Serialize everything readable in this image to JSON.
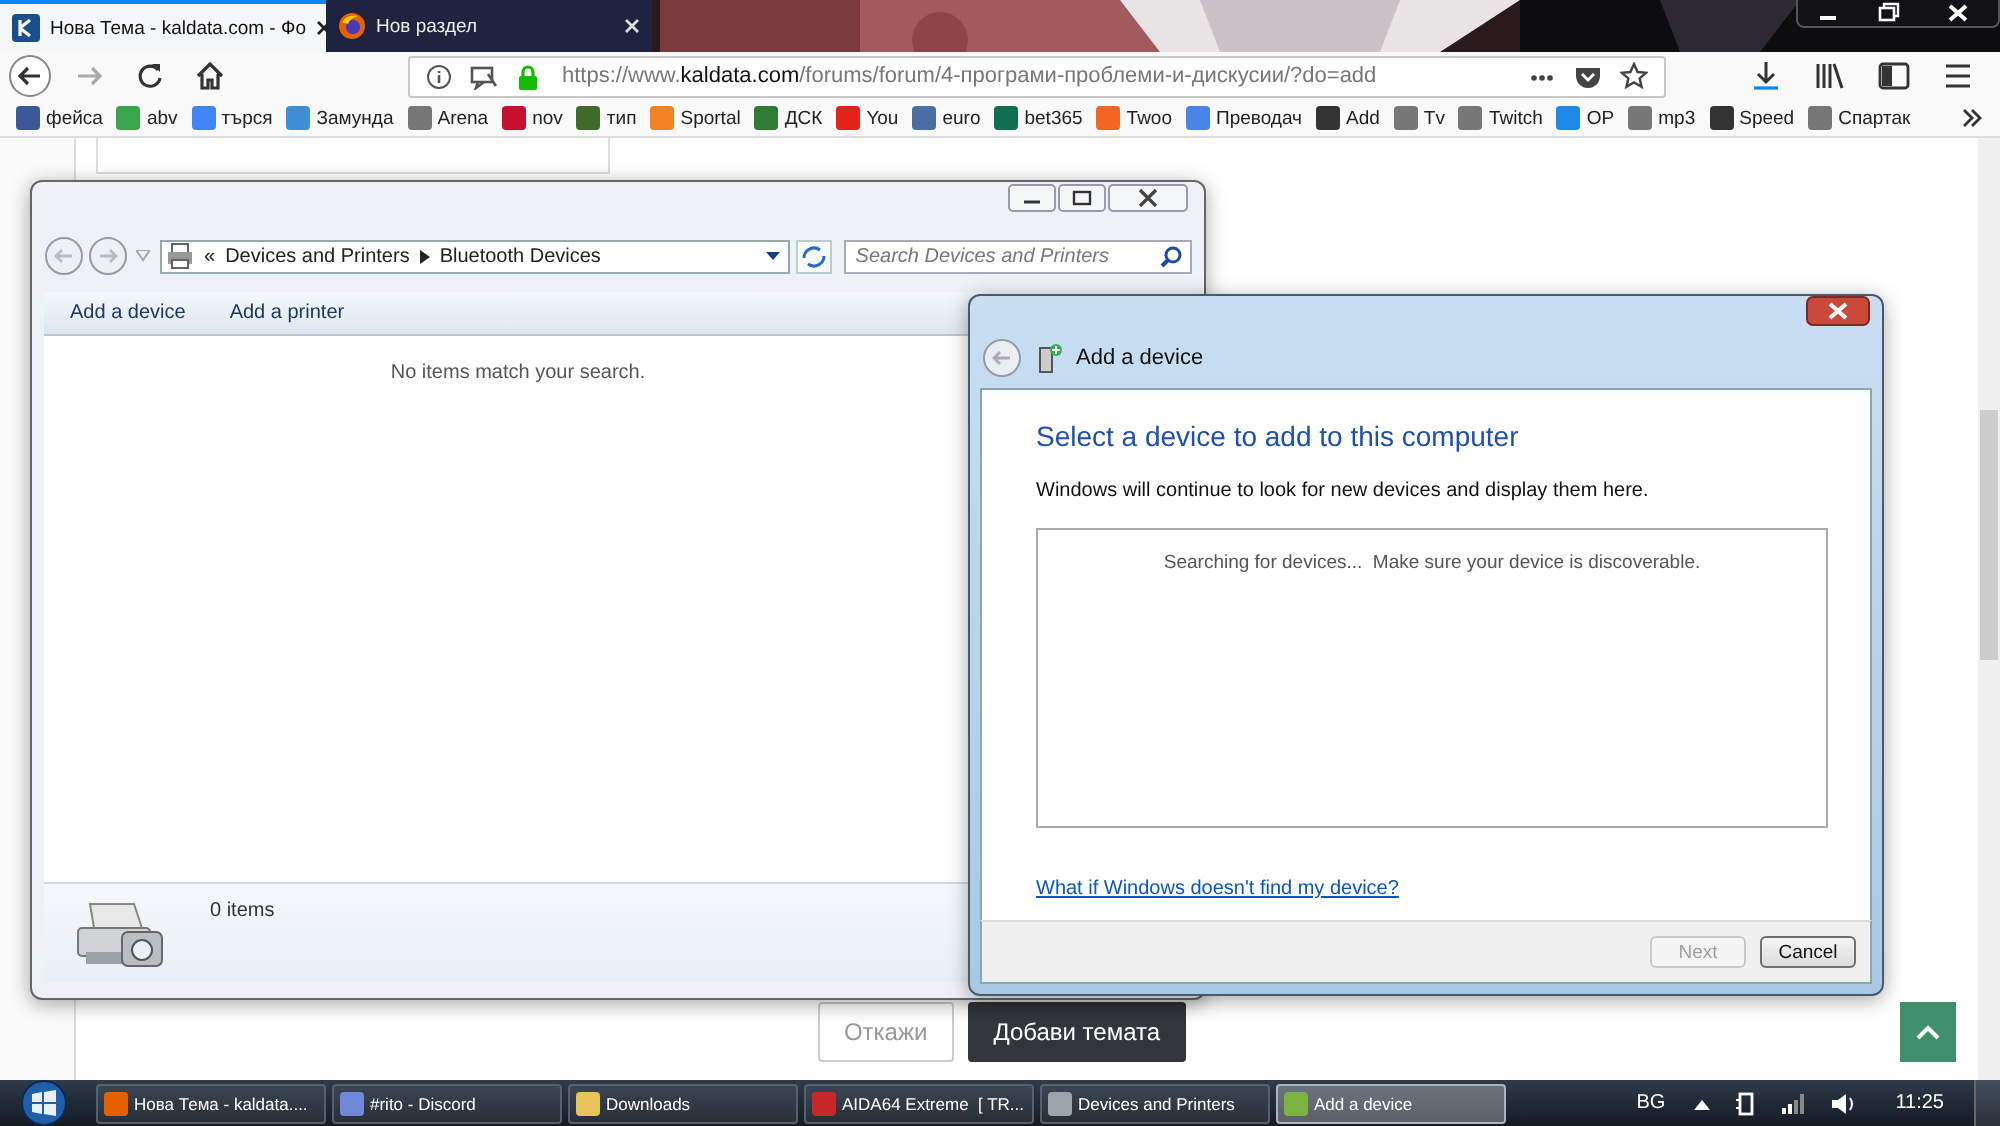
{
  "browser": {
    "tabs": [
      {
        "title": "Нова Тема - kaldata.com - Фо",
        "selected": true
      },
      {
        "title": "Нов раздел",
        "selected": false
      }
    ],
    "url": {
      "scheme": "https://www.",
      "domain": "kaldata.com",
      "path": "/forums/forum/4-програми-проблеми-и-дискусии/?do=add"
    },
    "bookmarks": [
      {
        "label": "фейса",
        "color": "#3b5998"
      },
      {
        "label": "abv",
        "color": "#3aa54a"
      },
      {
        "label": "търся",
        "color": "#4285f4"
      },
      {
        "label": "Замунда",
        "color": "#3d8fd8"
      },
      {
        "label": "Arena",
        "color": "#777777"
      },
      {
        "label": "nov",
        "color": "#c8102e"
      },
      {
        "label": "тип",
        "color": "#3f6b2a"
      },
      {
        "label": "Sportal",
        "color": "#f58220"
      },
      {
        "label": "ДСК",
        "color": "#2e7d32"
      },
      {
        "label": "You",
        "color": "#e62117"
      },
      {
        "label": "euro",
        "color": "#4a6fa5"
      },
      {
        "label": "bet365",
        "color": "#126e51"
      },
      {
        "label": "Twoo",
        "color": "#f26522"
      },
      {
        "label": "Преводач",
        "color": "#4a86e8"
      },
      {
        "label": "Add",
        "color": "#333333"
      },
      {
        "label": "Tv",
        "color": "#777777"
      },
      {
        "label": "Twitch",
        "color": "#777777"
      },
      {
        "label": "OP",
        "color": "#1e88e5"
      },
      {
        "label": "mp3",
        "color": "#777777"
      },
      {
        "label": "Speed",
        "color": "#333333"
      },
      {
        "label": "Спартак",
        "color": "#777777"
      }
    ],
    "page": {
      "buttons": [
        {
          "label": "Откажи",
          "kind": "secondary"
        },
        {
          "label": "Добави темата",
          "kind": "primary"
        }
      ]
    }
  },
  "explorer": {
    "breadcrumb_overflow": "«",
    "breadcrumbs": [
      "Devices and Printers",
      "Bluetooth Devices"
    ],
    "search": {
      "placeholder": "Search Devices and Printers"
    },
    "commands": [
      "Add a device",
      "Add a printer"
    ],
    "empty_message": "No items match your search.",
    "status": "0 items"
  },
  "dialog": {
    "title": "Add a device",
    "heading": "Select a device to add to this computer",
    "description": "Windows will continue to look for new devices and display them here.",
    "list_message": "Searching for devices...  Make sure your device is discoverable.",
    "link": "What if Windows doesn't find my device?",
    "buttons": [
      {
        "label": "Next",
        "disabled": true
      },
      {
        "label": "Cancel",
        "disabled": false
      }
    ]
  },
  "taskbar": {
    "items": [
      {
        "label": "Нова Тема - kaldata....",
        "color": "#e66000",
        "selected": false
      },
      {
        "label": "#rito - Discord",
        "color": "#7289da",
        "selected": false
      },
      {
        "label": "Downloads",
        "color": "#e8c35a",
        "selected": false
      },
      {
        "label": "AIDA64 Extreme  [ TR...",
        "color": "#c62828",
        "selected": false
      },
      {
        "label": "Devices and Printers",
        "color": "#9aa4ad",
        "selected": false
      },
      {
        "label": "Add a device",
        "color": "#7cb342",
        "selected": true
      }
    ],
    "language": "BG",
    "time": "11:25"
  }
}
